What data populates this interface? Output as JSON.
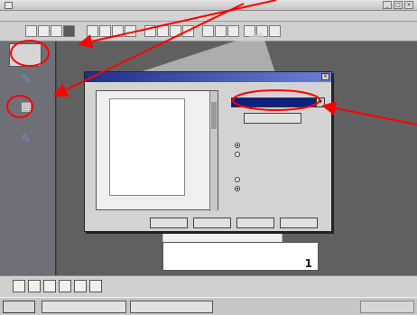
{
  "window": {
    "title": "",
    "menu": [
      "",
      "",
      "",
      ""
    ],
    "controls": [
      "_",
      "□",
      "×"
    ]
  },
  "side_panel": {
    "top_button": {
      "label": "",
      "sub": ""
    },
    "items": [
      {
        "label": "",
        "icon": "wrench-icon"
      },
      {
        "label": "",
        "icon": "page-layout-icon"
      },
      {
        "label": "",
        "icon": "pen-icon"
      }
    ],
    "footer": ""
  },
  "document": {
    "page_number": "1"
  },
  "dialog": {
    "title": "",
    "close": "×",
    "preview_text": "",
    "preview_footer": [
      "",
      ""
    ],
    "right_label": "",
    "select_value": "",
    "select_arrow": "▼",
    "settings_button": "",
    "group1_label": "",
    "group1_options": [
      {
        "label": "",
        "selected": true
      },
      {
        "label": "",
        "selected": false
      }
    ],
    "group2_label": "",
    "group2_options": [
      {
        "label": "",
        "selected": false
      },
      {
        "label": "",
        "selected": true
      }
    ],
    "bottom_buttons": [
      "",
      "",
      "",
      ""
    ]
  },
  "status": {
    "text": ""
  },
  "taskbar": {
    "start": "",
    "items": [
      "",
      ""
    ],
    "tray": ""
  },
  "annotations": {
    "color": "#ff0000"
  }
}
